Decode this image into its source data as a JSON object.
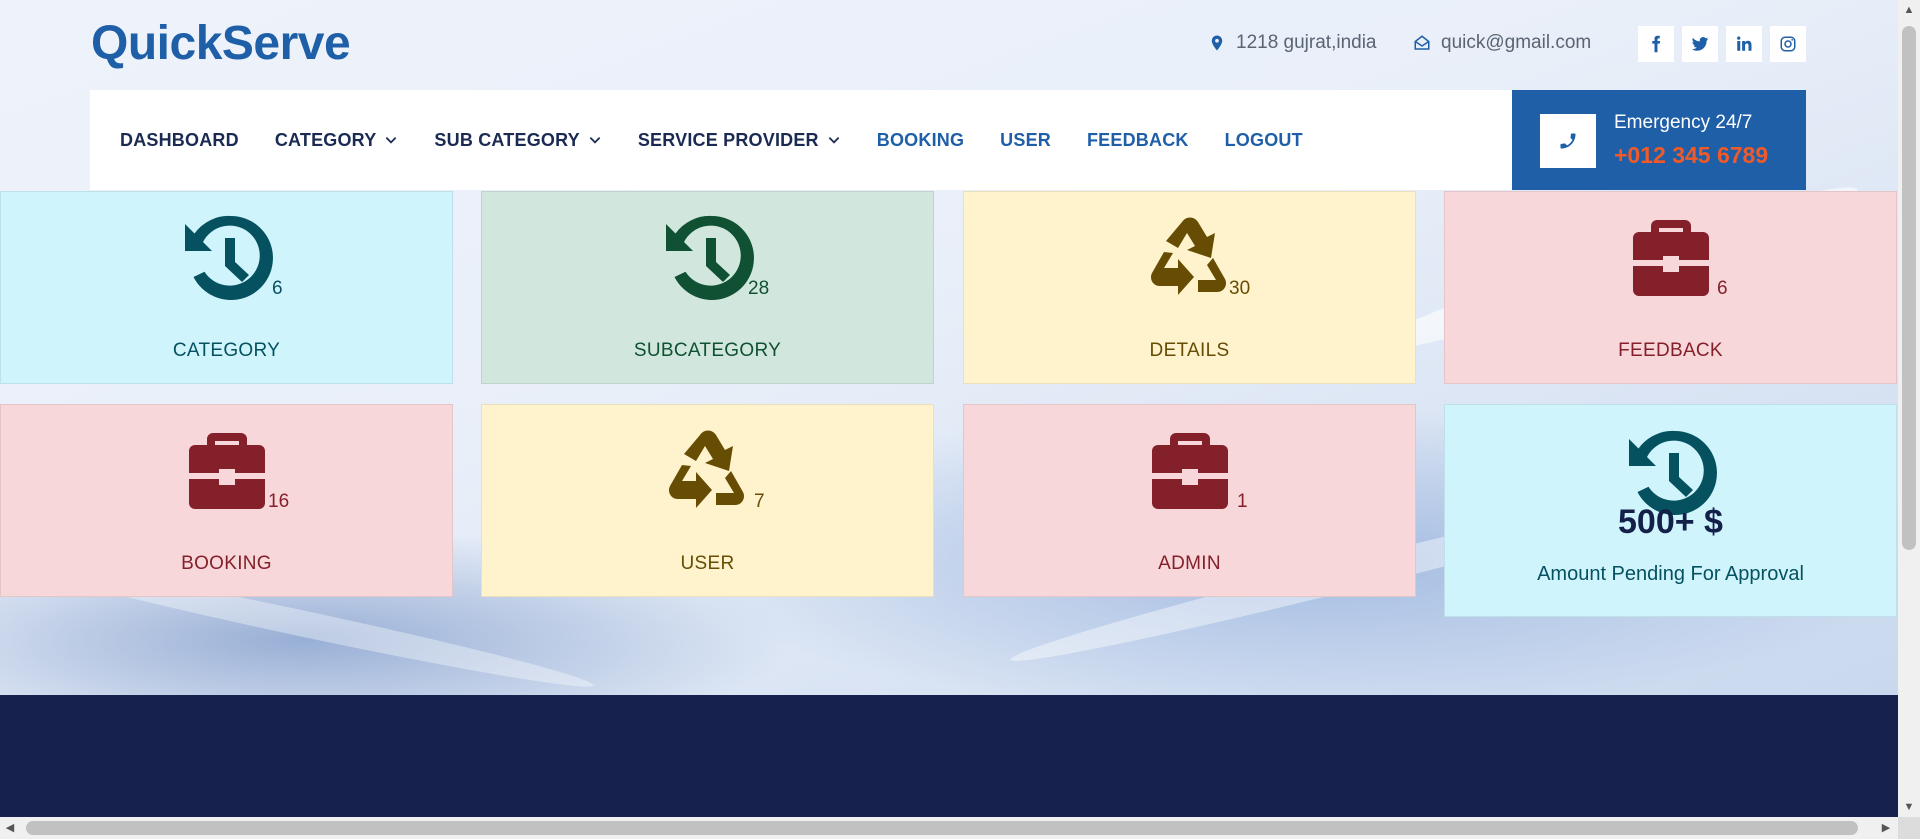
{
  "header": {
    "brand": "QuickServe",
    "address": "1218 gujrat,india",
    "email": "quick@gmail.com",
    "social": [
      "f",
      "t",
      "in",
      "ig"
    ]
  },
  "nav": {
    "items": [
      {
        "label": "DASHBOARD",
        "dropdown": false
      },
      {
        "label": "CATEGORY",
        "dropdown": true
      },
      {
        "label": "SUB CATEGORY",
        "dropdown": true
      },
      {
        "label": "SERVICE PROVIDER",
        "dropdown": true
      },
      {
        "label": "BOOKING",
        "dropdown": false
      },
      {
        "label": "USER",
        "dropdown": false
      },
      {
        "label": "FEEDBACK",
        "dropdown": false
      },
      {
        "label": "LOGOUT",
        "dropdown": false
      }
    ],
    "emergency_title": "Emergency 24/7",
    "emergency_phone": "+012 345 6789"
  },
  "cards": [
    {
      "label": "CATEGORY",
      "count": "6",
      "icon": "history-icon",
      "color": "#055160"
    },
    {
      "label": "SUBCATEGORY",
      "count": "28",
      "icon": "history-icon",
      "color": "#0f5132"
    },
    {
      "label": "DETAILS",
      "count": "30",
      "icon": "recycle-icon",
      "color": "#664d03"
    },
    {
      "label": "FEEDBACK",
      "count": "6",
      "icon": "briefcase-icon",
      "color": "#842029"
    },
    {
      "label": "BOOKING",
      "count": "16",
      "icon": "briefcase-icon",
      "color": "#842029"
    },
    {
      "label": "USER",
      "count": "7",
      "icon": "recycle-icon",
      "color": "#664d03"
    },
    {
      "label": "ADMIN",
      "count": "1",
      "icon": "briefcase-icon",
      "color": "#842029"
    }
  ],
  "pending": {
    "amount": "500+ $",
    "label": "Amount Pending For Approval",
    "icon": "history-icon"
  }
}
